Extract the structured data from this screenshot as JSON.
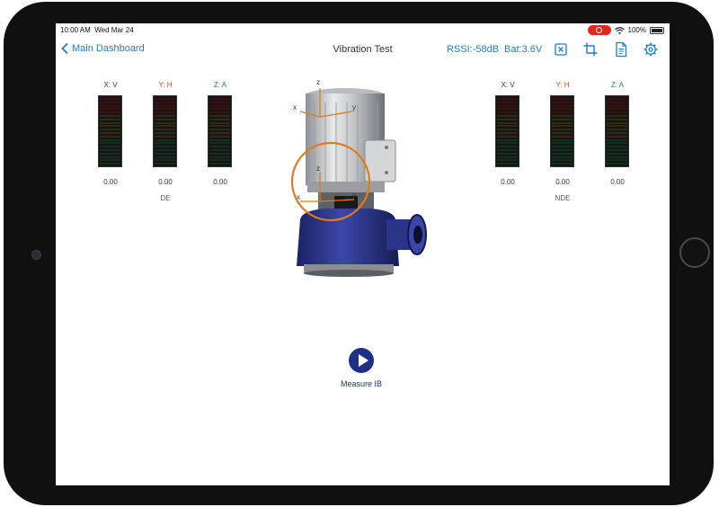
{
  "status_bar": {
    "time": "10:00 AM",
    "date": "Wed Mar 24",
    "battery": "100%",
    "recording_color": "#e0291d"
  },
  "nav": {
    "back_label": "Main Dashboard",
    "title": "Vibration Test",
    "rssi": "RSSI:-58dB",
    "battery": "Bat:3.6V",
    "icons": [
      "close-box-icon",
      "crop-icon",
      "document-icon",
      "gear-icon"
    ],
    "accent_color": "#1e7ec8"
  },
  "sensors": {
    "de": {
      "label": "DE",
      "axes": [
        {
          "label": "X: V",
          "value": "0.00",
          "color": "#1e2f86"
        },
        {
          "label": "Y: H",
          "value": "0.00",
          "color": "#d34b1b"
        },
        {
          "label": "Z: A",
          "value": "0.00",
          "color": "#1e8b3a"
        }
      ]
    },
    "nde": {
      "label": "NDE",
      "axes": [
        {
          "label": "X: V",
          "value": "0.00",
          "color": "#1e2f86"
        },
        {
          "label": "Y: H",
          "value": "0.00",
          "color": "#d34b1b"
        },
        {
          "label": "Z: A",
          "value": "0.00",
          "color": "#1e8b3a"
        }
      ]
    }
  },
  "pump": {
    "axis_labels": {
      "z": "z",
      "x": "x",
      "y": "y"
    },
    "highlight_color": "#e07b1c"
  },
  "action": {
    "measure_label": "Measure IB",
    "button_color": "#1e2f86"
  }
}
